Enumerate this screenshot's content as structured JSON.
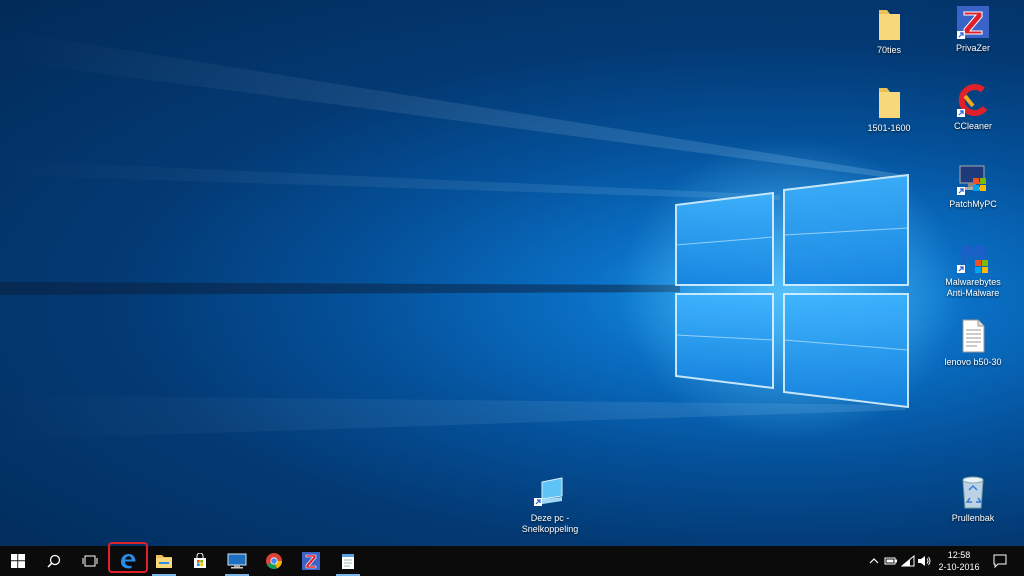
{
  "desktop": {
    "icons": [
      {
        "label": "70ties",
        "icon": "folder-icon"
      },
      {
        "label": "PrivaZer",
        "icon": "privazer-icon"
      },
      {
        "label": "1501-1600",
        "icon": "folder-icon"
      },
      {
        "label": "CCleaner",
        "icon": "ccleaner-icon"
      },
      {
        "label": "PatchMyPC",
        "icon": "patchmypc-icon"
      },
      {
        "label": "Malwarebytes Anti-Malware",
        "icon": "malwarebytes-icon"
      },
      {
        "label": "lenovo b50-30",
        "icon": "text-document-icon"
      },
      {
        "label": "Deze pc - Snelkoppeling",
        "icon": "this-pc-icon"
      },
      {
        "label": "Prullenbak",
        "icon": "recycle-bin-icon"
      }
    ]
  },
  "taskbar": {
    "buttons": [
      {
        "name": "start",
        "icon": "windows-logo-icon"
      },
      {
        "name": "search",
        "icon": "search-icon"
      },
      {
        "name": "task-view",
        "icon": "task-view-icon"
      },
      {
        "name": "edge",
        "icon": "edge-icon",
        "highlighted": true
      },
      {
        "name": "file-explorer",
        "icon": "folder-icon"
      },
      {
        "name": "store",
        "icon": "store-icon"
      },
      {
        "name": "app-monitor",
        "icon": "monitor-icon"
      },
      {
        "name": "chrome",
        "icon": "chrome-icon"
      },
      {
        "name": "privazer",
        "icon": "privazer-icon"
      },
      {
        "name": "notepad",
        "icon": "notepad-icon"
      }
    ],
    "tray": {
      "icons": [
        "chevron-up-icon",
        "battery-icon",
        "wifi-icon",
        "volume-icon"
      ],
      "time": "12:58",
      "date": "2-10-2016",
      "action_center_icon": "notification-icon"
    },
    "highlight_color": "#e0212b"
  }
}
